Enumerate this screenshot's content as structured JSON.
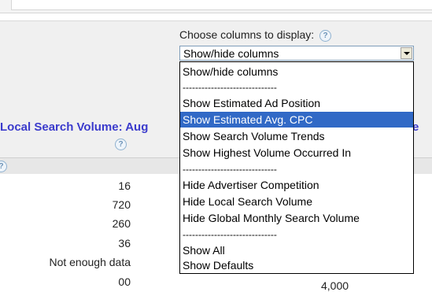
{
  "column_chooser": {
    "label": "Choose columns to display:",
    "help": "?",
    "selected_value": "Show/hide columns"
  },
  "dropdown": {
    "options": [
      {
        "label": "Show/hide columns",
        "kind": "option"
      },
      {
        "label": "------------------------------",
        "kind": "separator"
      },
      {
        "label": "Show Estimated Ad Position",
        "kind": "option"
      },
      {
        "label": "Show Estimated Avg. CPC",
        "kind": "option",
        "selected": true
      },
      {
        "label": "Show Search Volume Trends",
        "kind": "option"
      },
      {
        "label": "Show Highest Volume Occurred In",
        "kind": "option"
      },
      {
        "label": "------------------------------",
        "kind": "separator"
      },
      {
        "label": "Hide Advertiser Competition",
        "kind": "option"
      },
      {
        "label": "Hide Local Search Volume",
        "kind": "option"
      },
      {
        "label": "Hide Global Monthly Search Volume",
        "kind": "option"
      },
      {
        "label": "------------------------------",
        "kind": "separator"
      },
      {
        "label": "Show All",
        "kind": "option"
      },
      {
        "label": "Show Defaults",
        "kind": "option"
      }
    ]
  },
  "table": {
    "local_header": "Local Search Volume: Aug",
    "right_header_fragment": "e",
    "help": "?",
    "local_volume_values": [
      "16",
      "720",
      "260",
      "36",
      "Not enough data",
      "00"
    ],
    "global_values_partial": [
      "",
      "",
      "",
      "",
      "000",
      "4,000"
    ]
  },
  "colors": {
    "header_text": "#3b3bcc",
    "selected_option_bg": "#3169c6",
    "band_bg": "#f0f0f0"
  }
}
